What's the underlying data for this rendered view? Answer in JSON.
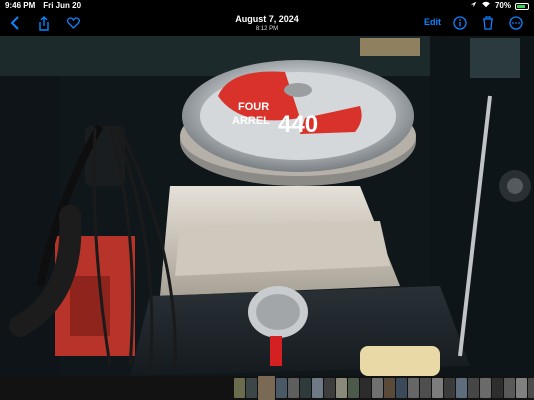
{
  "status": {
    "time": "9:46 PM",
    "date": "Fri Jun 20",
    "battery": "70%"
  },
  "nav": {
    "title": "August 7, 2024",
    "subtitle": "8:12 PM",
    "edit_label": "Edit"
  },
  "photo": {
    "air_cleaner_label_1": "FOUR",
    "air_cleaner_label_2": "ARREL",
    "engine_size": "440"
  },
  "filmstrip": {
    "thumbnail_colors": [
      "#6b6b4e",
      "#3c4646",
      "#7a6a55",
      "#4a5966",
      "#5e5e5e",
      "#2f3a3a",
      "#6e7a85",
      "#3d3d3d",
      "#8a8a7a",
      "#4b5a4b",
      "#2c2c2c",
      "#707070",
      "#5a4a3a",
      "#3a4a5a",
      "#666666",
      "#4e4e4e",
      "#7d7d7d",
      "#3b3b3b",
      "#5d6d7d",
      "#464646",
      "#6a6a6a",
      "#2e2e2e",
      "#595959",
      "#808080",
      "#4c4c4c"
    ]
  }
}
